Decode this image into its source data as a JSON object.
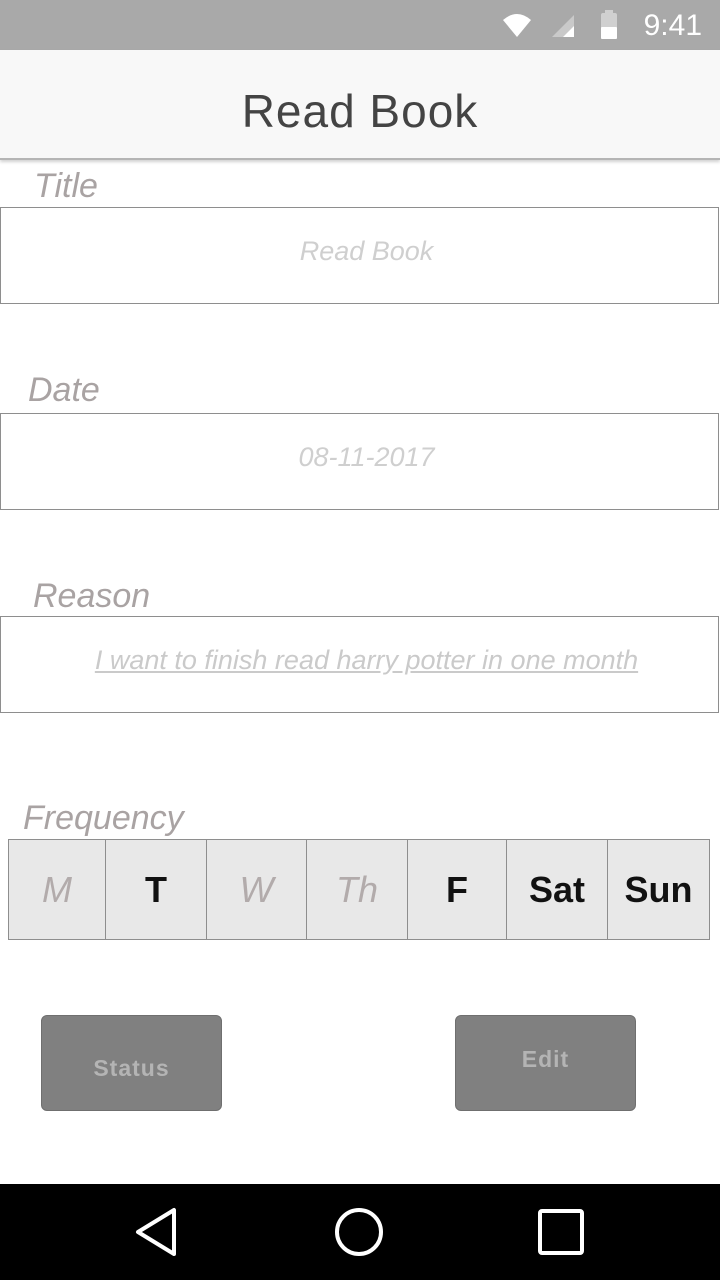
{
  "status_bar": {
    "time": "9:41",
    "icons": [
      "wifi-icon",
      "signal-icon",
      "battery-icon"
    ]
  },
  "app_bar": {
    "title": "Read Book"
  },
  "form": {
    "title": {
      "label": "Title",
      "value": "Read Book"
    },
    "date": {
      "label": "Date",
      "value": "08-11-2017"
    },
    "reason": {
      "label": "Reason",
      "value": "I want to finish read harry potter in one month"
    }
  },
  "frequency": {
    "label": "Frequency",
    "days": [
      {
        "label": "M",
        "selected": false
      },
      {
        "label": "T",
        "selected": true
      },
      {
        "label": "W",
        "selected": false
      },
      {
        "label": "Th",
        "selected": false
      },
      {
        "label": "F",
        "selected": true
      },
      {
        "label": "Sat",
        "selected": true
      },
      {
        "label": "Sun",
        "selected": true
      }
    ]
  },
  "buttons": {
    "status": "Status",
    "edit": "Edit"
  },
  "nav_bar": {
    "icons": [
      "back-icon",
      "home-icon",
      "recents-icon"
    ]
  },
  "colors": {
    "status_bar_bg": "#a9a9a9",
    "app_bar_bg": "#f8f8f8",
    "button_bg": "#808080",
    "day_selected": "#111111",
    "day_unselected": "#b2abab"
  }
}
